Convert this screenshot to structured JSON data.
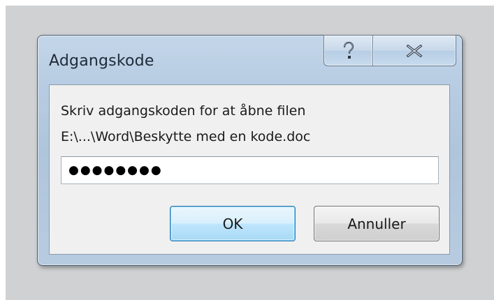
{
  "dialog": {
    "title": "Adgangskode",
    "help_label": "?",
    "close_label": "✕"
  },
  "content": {
    "prompt": "Skriv adgangskoden for at åbne filen",
    "file_path": "E:\\...\\Word\\Beskytte med en kode.doc",
    "password_value": "●●●●●●●●"
  },
  "buttons": {
    "ok_label": "OK",
    "cancel_label": "Annuller"
  }
}
